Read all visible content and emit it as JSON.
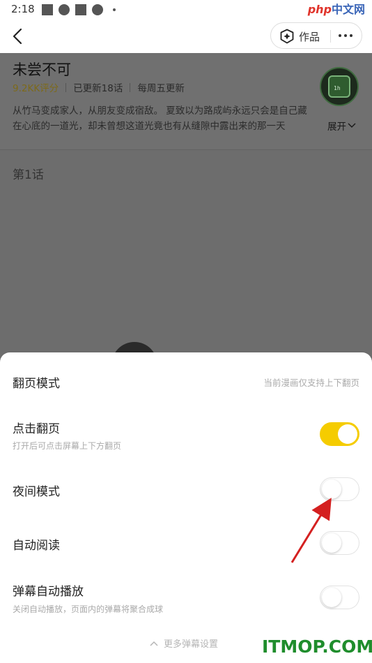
{
  "status_bar": {
    "time": "2:18",
    "icons": [
      "square-icon",
      "pinwheel-icon",
      "square-icon",
      "pinwheel-icon",
      "dot-icon"
    ],
    "watermark": {
      "php": "php",
      "text": "中文网"
    }
  },
  "header": {
    "back_icon": "chevron-left-icon",
    "works_icon": "diamond-badge-icon",
    "works_label": "作品",
    "more_icon": "more-dots-icon"
  },
  "comic": {
    "title": "未尝不可",
    "rating": "9.2KK评分",
    "updated": "已更新18话",
    "schedule": "每周五更新",
    "description_line1": "从竹马变成家人，从朋友变成宿敌。 夏致以为路成屿永远只会是自己藏",
    "description_line2": "在心底的一道光，却未曾想这道光竟也有从缝隙中露出来的那一天",
    "expand_label": "展开",
    "avatar_text": "1h"
  },
  "episode": {
    "label": "第1话"
  },
  "settings": {
    "page_mode": {
      "label": "翻页模式",
      "note": "当前漫画仅支持上下翻页"
    },
    "tap_page": {
      "label": "点击翻页",
      "sub": "打开后可点击屏幕上下方翻页",
      "on": true
    },
    "night_mode": {
      "label": "夜间模式",
      "on": false
    },
    "auto_read": {
      "label": "自动阅读",
      "on": false
    },
    "danmu_auto": {
      "label": "弹幕自动播放",
      "sub": "关闭自动播放，页面内的弹幕将聚合成球",
      "on": false
    },
    "more_danmu": "更多弹幕设置"
  },
  "watermark_bottom": "ITMOP.COM",
  "colors": {
    "toggle_on": "#f5cc00",
    "arrow": "#d42020",
    "watermark_green": "#1f8d2c"
  }
}
